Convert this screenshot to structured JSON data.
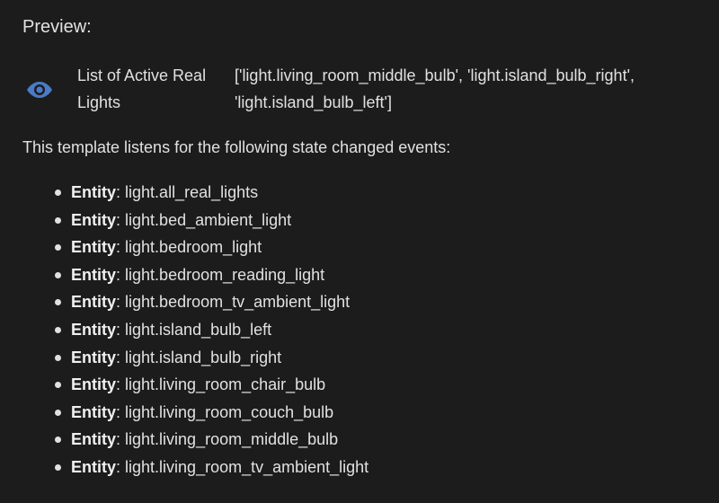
{
  "preview": {
    "heading": "Preview:",
    "entity_icon": "eye-icon",
    "entity_name": "List of Active Real Lights",
    "entity_state": "['light.living_room_middle_bulb', 'light.island_bulb_right', 'light.island_bulb_left']"
  },
  "listeners": {
    "intro": "This template listens for the following state changed events:",
    "type_label": "Entity",
    "separator": ": ",
    "entities": [
      "light.all_real_lights",
      "light.bed_ambient_light",
      "light.bedroom_light",
      "light.bedroom_reading_light",
      "light.bedroom_tv_ambient_light",
      "light.island_bulb_left",
      "light.island_bulb_right",
      "light.living_room_chair_bulb",
      "light.living_room_couch_bulb",
      "light.living_room_middle_bulb",
      "light.living_room_tv_ambient_light"
    ]
  },
  "colors": {
    "background": "#1c1c1c",
    "text": "#e1e1e1",
    "icon": "#4a7bc8"
  }
}
